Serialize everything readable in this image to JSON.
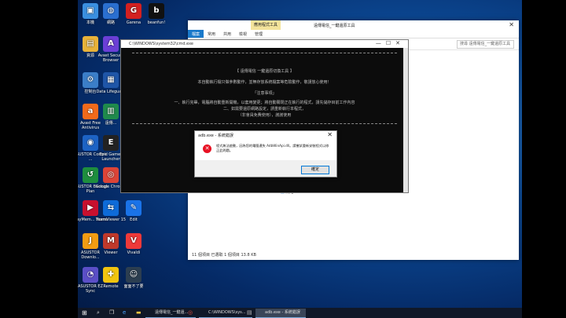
{
  "desktop_icons": [
    {
      "label": "本機",
      "color": "#3a8fe0",
      "glyph": "▣"
    },
    {
      "label": "網路",
      "color": "#2a6fd0",
      "glyph": "◍"
    },
    {
      "label": "Garena",
      "color": "#d32020",
      "glyph": "G"
    },
    {
      "label": "beanfun!",
      "color": "#111",
      "glyph": "b"
    },
    {
      "label": "資源",
      "color": "#e8b23a",
      "glyph": "▤"
    },
    {
      "label": "Avast Secure Browser",
      "color": "#6b3fd6",
      "glyph": "A"
    },
    {
      "label": "控制台",
      "color": "#3b7ec8",
      "glyph": "⚙"
    },
    {
      "label": "Data Lifeguard",
      "color": "#1f56a8",
      "glyph": "▦"
    },
    {
      "label": "Avast Free Antivirus",
      "color": "#f26a1b",
      "glyph": "a"
    },
    {
      "label": "遠傳...",
      "color": "#1f8a4c",
      "glyph": "▥"
    },
    {
      "label": "ASUSTOR Control ...",
      "color": "#1d63c4",
      "glyph": "◉"
    },
    {
      "label": "Epic Games Launcher",
      "color": "#222",
      "glyph": "E"
    },
    {
      "label": "ASUSTOR Backup Plan",
      "color": "#1e8e3e",
      "glyph": "↺"
    },
    {
      "label": "Google Chrome",
      "color": "#db4437",
      "glyph": "◎"
    },
    {
      "label": "PlayMem... Home",
      "color": "#c8102e",
      "glyph": "▶"
    },
    {
      "label": "TeamViewer 15",
      "color": "#0e6bd8",
      "glyph": "⇆"
    },
    {
      "label": "Edit",
      "color": "#1a73e8",
      "glyph": "✎"
    },
    {
      "label": "ASUSTOR Downlo...",
      "color": "#f39c12",
      "glyph": "J"
    },
    {
      "label": "Viewer",
      "color": "#c0392b",
      "glyph": "M"
    },
    {
      "label": "Vivaldi",
      "color": "#ef3939",
      "glyph": "V"
    },
    {
      "label": "ASUSTOR EZ Sync",
      "color": "#5b4fc7",
      "glyph": "◔"
    },
    {
      "label": "Remote",
      "color": "#f1c40f",
      "glyph": "✚"
    },
    {
      "label": "面面不了要",
      "color": "#2c3e50",
      "glyph": "☺"
    }
  ],
  "explorer": {
    "title": "遠傳電信_一鍵還原工具",
    "context_tab": "應用程式工具",
    "ribbon_tabs": [
      "檔案",
      "常用",
      "共用",
      "檢視",
      "管理"
    ],
    "search_placeholder": "搜尋 遠傳電信_一鍵還原工具",
    "nav_item": "網路",
    "status": "11 個項目   已選取 1 個項目 13.8 KB"
  },
  "cmd": {
    "title": "C:\\WINDOWS\\system32\\cmd.exe",
    "lines": [
      "【 遠傳電信 一鍵還原切換工具 】",
      "本自動執行檔只做參數動作，並無存放系統檔案等危險動作，敬請放心使用！",
      "「注意事項」",
      "一、執行完畢，電腦將自動重新開機，以套用變更；將自動關閉正在執行的程式，請先儲存目前工作內容",
      "二、如需要還原網路設定，請重新執行本程式，",
      "（非會員免費使用），謝謝使用"
    ]
  },
  "dialog": {
    "title": "adb.exe - 系統錯誤",
    "message": "程式無法啟動，因為您的電腦遺失 AdbWinApi.dll。請嘗試重新安裝程式以修正此問題。",
    "ok_label": "確定"
  },
  "taskbar": {
    "tasks": [
      "遠傳電信_一鍵還...",
      "C:\\WINDOWS\\sys...",
      "adb.exe - 系統錯誤"
    ]
  }
}
